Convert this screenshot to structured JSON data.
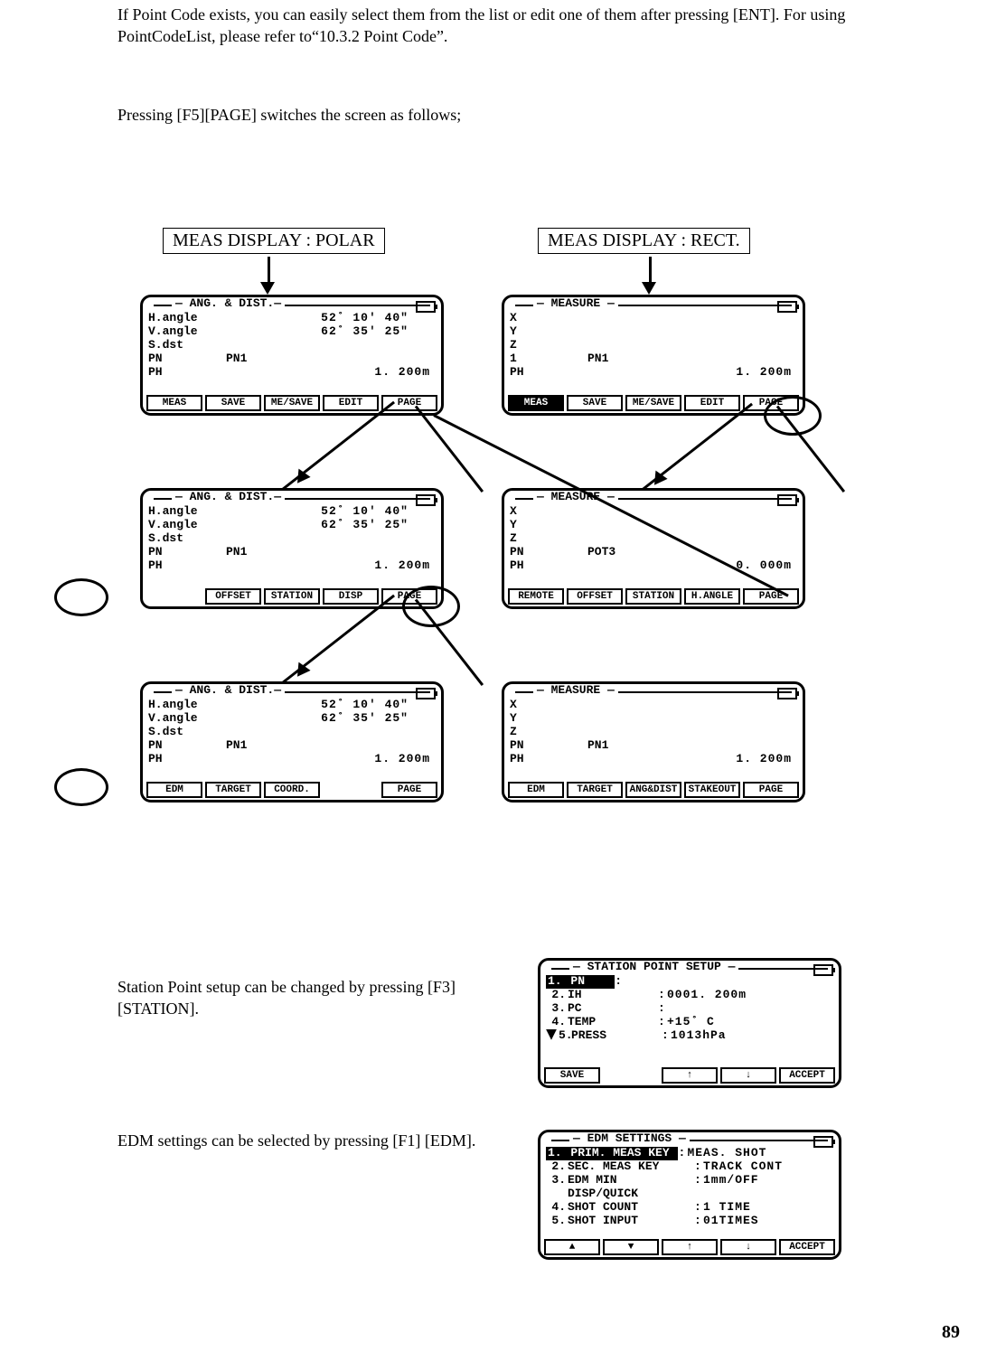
{
  "para1": "If Point Code exists, you can easily select them from the list or edit one of them after pressing [ENT]. For using PointCodeList, please refer to“10.3.2 Point Code”.",
  "para2": "Pressing [F5][PAGE] switches the screen as follows;",
  "label_polar": "MEAS DISPLAY : POLAR",
  "label_rect": "MEAS DISPLAY : RECT.",
  "polar": {
    "title": "— ANG. & DIST.—",
    "rows": {
      "h": {
        "lab": "H.angle",
        "val": "52˚ 10' 40\""
      },
      "v": {
        "lab": "V.angle",
        "val": "62˚ 35' 25\""
      },
      "s": {
        "lab": "S.dst",
        "val": ""
      },
      "pn": {
        "lab": "PN",
        "mid": "PN1"
      },
      "ph": {
        "lab": "PH",
        "val": "1. 200m"
      }
    },
    "sk1": [
      "MEAS",
      "SAVE",
      "ME/SAVE",
      "EDIT",
      "PAGE"
    ],
    "sk2": [
      "",
      "OFFSET",
      "STATION",
      "DISP",
      "PAGE"
    ],
    "sk3": [
      "EDM",
      "TARGET",
      "COORD.",
      "",
      "PAGE"
    ]
  },
  "rect": {
    "title": "— MEASURE —",
    "rowsA": {
      "x": "X",
      "y": "Y",
      "z": "Z",
      "one": {
        "lab": "1",
        "mid": "PN1"
      },
      "ph": {
        "lab": "PH",
        "val": "1. 200m"
      }
    },
    "rowsB": {
      "x": "X",
      "y": "Y",
      "z": "Z",
      "pn": {
        "lab": "PN",
        "mid": "POT3"
      },
      "ph": {
        "lab": "PH",
        "val": "0. 000m"
      }
    },
    "rowsC": {
      "x": "X",
      "y": "Y",
      "z": "Z",
      "pn": {
        "lab": "PN",
        "mid": "PN1"
      },
      "ph": {
        "lab": "PH",
        "val": "1. 200m"
      }
    },
    "sk1": [
      "MEAS",
      "SAVE",
      "ME/SAVE",
      "EDIT",
      "PAGE"
    ],
    "sk2": [
      "REMOTE",
      "OFFSET",
      "STATION",
      "H.ANGLE",
      "PAGE"
    ],
    "sk3": [
      "EDM",
      "TARGET",
      "ANG&DIST",
      "STAKEOUT",
      "PAGE"
    ]
  },
  "station_text": "Station Point setup can be changed by pressing [F3] [STATION].",
  "edm_text": "EDM settings can be selected by pressing [F1] [EDM].",
  "station_screen": {
    "title": "— STATION POINT SETUP —",
    "rows": [
      {
        "n": "1.",
        "k": "PN",
        "v": "",
        "inv": true
      },
      {
        "n": "2.",
        "k": "IH",
        "v": "0001. 200m"
      },
      {
        "n": "3.",
        "k": "PC",
        "v": ""
      },
      {
        "n": "4.",
        "k": "TEMP",
        "v": " +15˚ C"
      },
      {
        "n": "5.",
        "k": "PRESS",
        "v": "1013hPa"
      }
    ],
    "sk": [
      "SAVE",
      "",
      "↑",
      "↓",
      "ACCEPT"
    ]
  },
  "edm_screen": {
    "title": "— EDM SETTINGS —",
    "rows": [
      {
        "n": "1.",
        "k": "PRIM. MEAS KEY",
        "v": "MEAS. SHOT",
        "inv": true
      },
      {
        "n": "2.",
        "k": "SEC. MEAS KEY",
        "v": "TRACK CONT"
      },
      {
        "n": "3.",
        "k": "EDM MIN DISP/QUICK",
        "v": "1mm/OFF"
      },
      {
        "n": "4.",
        "k": "SHOT COUNT",
        "v": "1 TIME"
      },
      {
        "n": "5.",
        "k": "SHOT INPUT",
        "v": "01TIMES"
      }
    ],
    "sk": [
      "▲",
      "▼",
      "↑",
      "↓",
      "ACCEPT"
    ]
  },
  "page_number": "89"
}
